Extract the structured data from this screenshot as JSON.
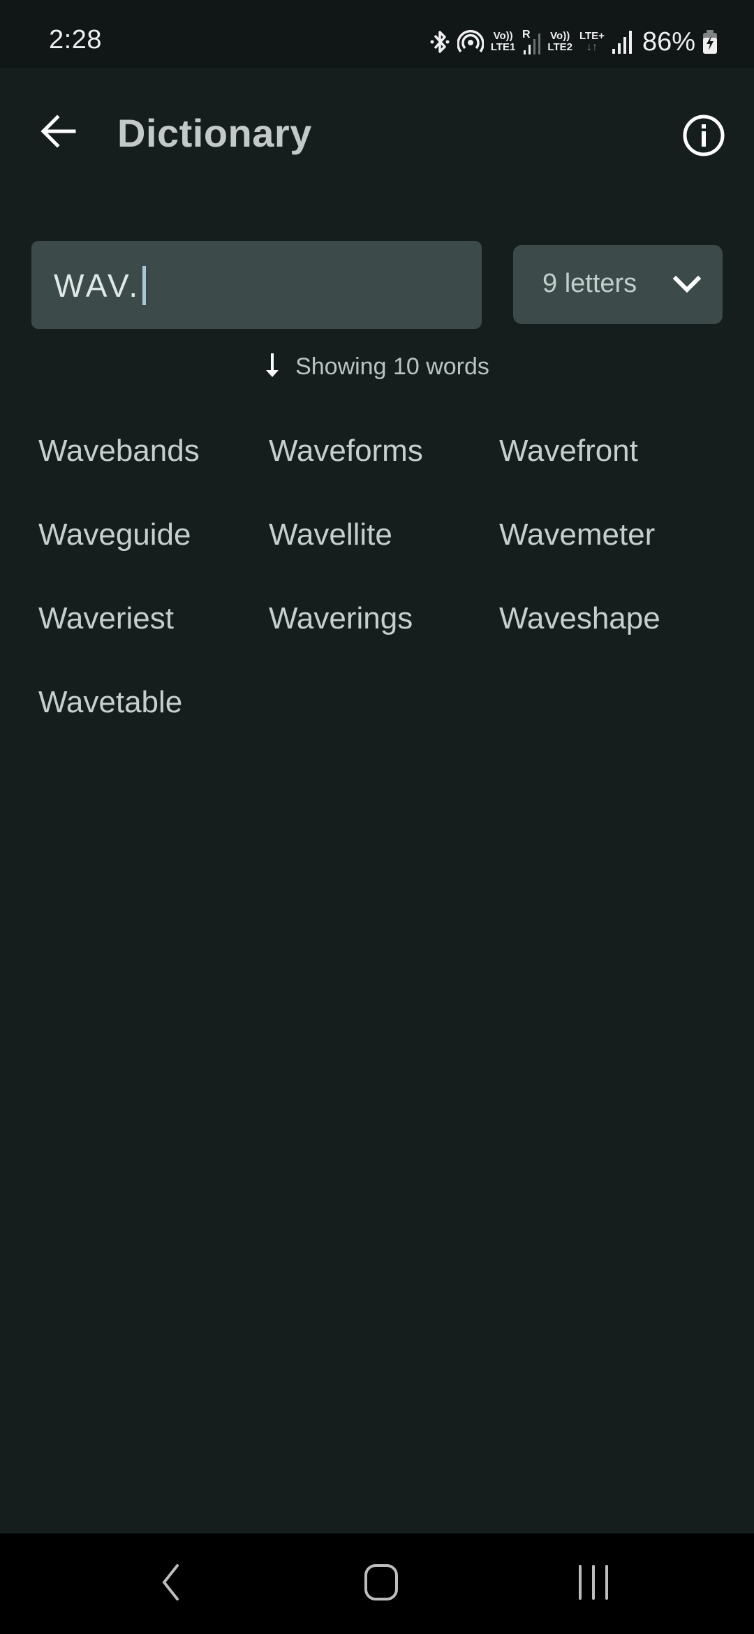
{
  "status_bar": {
    "time": "2:28",
    "icons": [
      "bluetooth-icon",
      "hotspot-icon",
      "volte-lte1-icon",
      "signal-roaming-icon",
      "volte-lte2-icon",
      "lte-plus-data-icon",
      "signal-icon",
      "battery-charging-icon"
    ],
    "sim1": {
      "volte": "Vo))",
      "network": "LTE1",
      "roaming": "R"
    },
    "sim2": {
      "volte": "Vo))",
      "network": "LTE2"
    },
    "data_type": "LTE+",
    "data_arrows": "↓↑",
    "battery_percent": "86%"
  },
  "app_bar": {
    "back_icon": "arrow-left-icon",
    "title": "Dictionary",
    "info_icon": "info-circle-icon"
  },
  "search": {
    "value": "WAV.",
    "placeholder": ""
  },
  "length_filter": {
    "selected": "9 letters",
    "icon": "chevron-down-icon"
  },
  "results": {
    "sort_icon": "arrow-down-icon",
    "summary": "Showing 10 words",
    "words": [
      "Wavebands",
      "Waveforms",
      "Wavefront",
      "Waveguide",
      "Wavellite",
      "Wavemeter",
      "Waveriest",
      "Waverings",
      "Waveshape",
      "Wavetable"
    ]
  },
  "nav_bar": {
    "back": "nav-back-icon",
    "home": "nav-home-icon",
    "recents": "nav-recents-icon"
  },
  "colors": {
    "background": "#161e1d",
    "status_bar": "#111617",
    "field": "#3c4b49",
    "caret": "#a7c7d1",
    "text": "#c5d0ce"
  }
}
